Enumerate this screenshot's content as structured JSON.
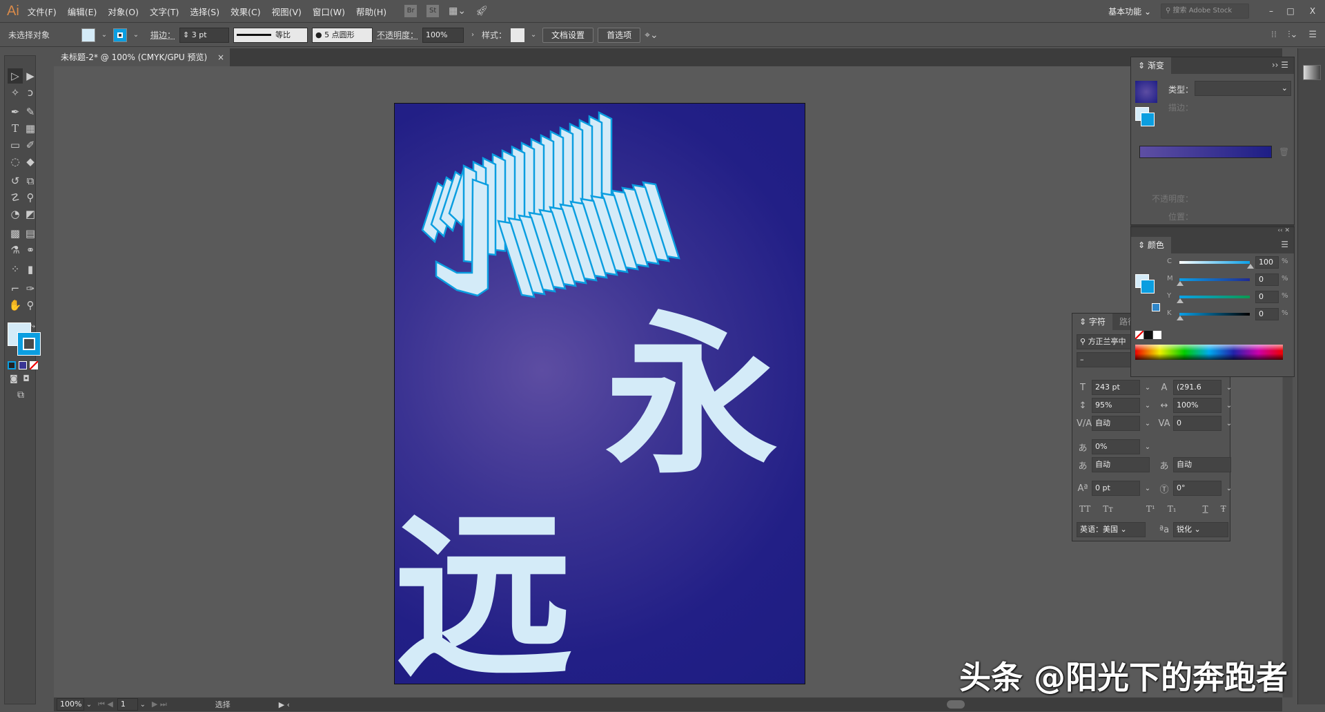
{
  "app": {
    "logo": "Ai"
  },
  "menu": [
    "文件(F)",
    "编辑(E)",
    "对象(O)",
    "文字(T)",
    "选择(S)",
    "效果(C)",
    "视图(V)",
    "窗口(W)",
    "帮助(H)"
  ],
  "menu_icons": {
    "bridge": "Br",
    "stock": "St"
  },
  "workspace": "基本功能",
  "search_placeholder": "搜索 Adobe Stock",
  "window_controls": {
    "minimize": "–",
    "maximize": "□",
    "close": "X"
  },
  "control": {
    "selection": "未选择对象",
    "stroke_label": "描边：",
    "stroke_value": "3 pt",
    "profile_label": "等比",
    "brush_label": "5 点圆形",
    "opacity_label": "不透明度：",
    "opacity_value": "100%",
    "style_label": "样式：",
    "doc_setup": "文档设置",
    "prefs": "首选项",
    "fill_color": "#d4ebf8",
    "stroke_color": "#0b9ee0"
  },
  "document_tab": {
    "title": "未标题-2* @ 100% (CMYK/GPU 预览)",
    "close": "×"
  },
  "artwork": {
    "char1": "永",
    "char2": "远",
    "gradient_center": "#5d4da2",
    "gradient_edge": "#1d1d82",
    "text_fill": "#d4ebf8",
    "text_stroke": "#0b9ee0"
  },
  "gradient_panel": {
    "title": "渐变",
    "type_label": "类型：",
    "stroke_label": "描边：",
    "opacity_label": "不透明度：",
    "location_label": "位置：",
    "ramp_start": "#5e4fa3",
    "ramp_end": "#1e1e86"
  },
  "color_panel": {
    "title": "颜色",
    "channels": [
      {
        "name": "C",
        "value": "100"
      },
      {
        "name": "M",
        "value": "0"
      },
      {
        "name": "Y",
        "value": "0"
      },
      {
        "name": "K",
        "value": "0"
      }
    ],
    "unit": "%"
  },
  "character_panel": {
    "tabs": [
      "字符",
      "路径文"
    ],
    "font_family": "方正兰亭中",
    "font_style": "–",
    "size": "243 pt",
    "leading": "(291.6",
    "vscale": "95%",
    "hscale": "100%",
    "kerning": "自动",
    "tracking": "0",
    "tsume": "0%",
    "aki_left": "自动",
    "aki_right": "自动",
    "baseline": "0 pt",
    "rotation": "0°",
    "styles": [
      "TT",
      "Tт",
      "T¹",
      "T₁",
      "T",
      "Ŧ"
    ],
    "language": "英语：美国",
    "antialias": "锐化"
  },
  "status": {
    "zoom": "100%",
    "artboard": "1",
    "tool": "选择"
  },
  "watermark": "头条 @阳光下的奔跑者"
}
